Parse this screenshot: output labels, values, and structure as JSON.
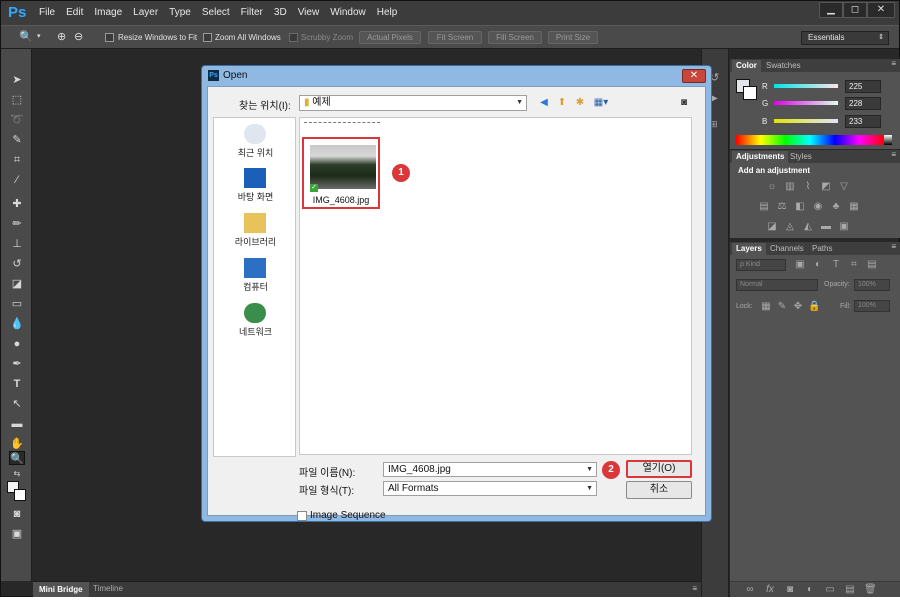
{
  "app": {
    "logo": "Ps",
    "menu": [
      "File",
      "Edit",
      "Image",
      "Layer",
      "Type",
      "Select",
      "Filter",
      "3D",
      "View",
      "Window",
      "Help"
    ],
    "window_controls": [
      "▁",
      "◻",
      "✕"
    ]
  },
  "options_bar": {
    "resize_windows_label": "Resize Windows to Fit",
    "zoom_all_label": "Zoom All Windows",
    "scrubby_zoom_label": "Scrubby Zoom",
    "buttons": [
      "Actual Pixels",
      "Fit Screen",
      "Fill Screen",
      "Print Size"
    ],
    "workspace": "Essentials"
  },
  "bottom_tabs": [
    "Mini Bridge",
    "Timeline"
  ],
  "color_panel": {
    "tabs": [
      "Color",
      "Swatches"
    ],
    "r_label": "R",
    "g_label": "G",
    "b_label": "B",
    "r_value": "225",
    "g_value": "228",
    "b_value": "233"
  },
  "adjustments_panel": {
    "tabs": [
      "Adjustments",
      "Styles"
    ],
    "heading": "Add an adjustment"
  },
  "layers_panel": {
    "tabs": [
      "Layers",
      "Channels",
      "Paths"
    ],
    "kind_label": "ρ Kind",
    "blend_mode": "Normal",
    "opacity_label": "Opacity:",
    "opacity_value": "100%",
    "lock_label": "Lock:",
    "fill_label": "Fill:",
    "fill_value": "100%"
  },
  "open_dialog": {
    "title": "Open",
    "look_in_label": "찾는 위치(I):",
    "look_in_value": "예제",
    "places": [
      "최근 위치",
      "바탕 화면",
      "라이브러리",
      "컴퓨터",
      "네트워크"
    ],
    "file_name": "IMG_4608.jpg",
    "file_name_label": "파일 이름(N):",
    "file_name_value": "IMG_4608.jpg",
    "file_type_label": "파일 형식(T):",
    "file_type_value": "All Formats",
    "open_button": "열기(O)",
    "cancel_button": "취소",
    "image_sequence_label": "Image Sequence",
    "badges": [
      "1",
      "2"
    ]
  }
}
